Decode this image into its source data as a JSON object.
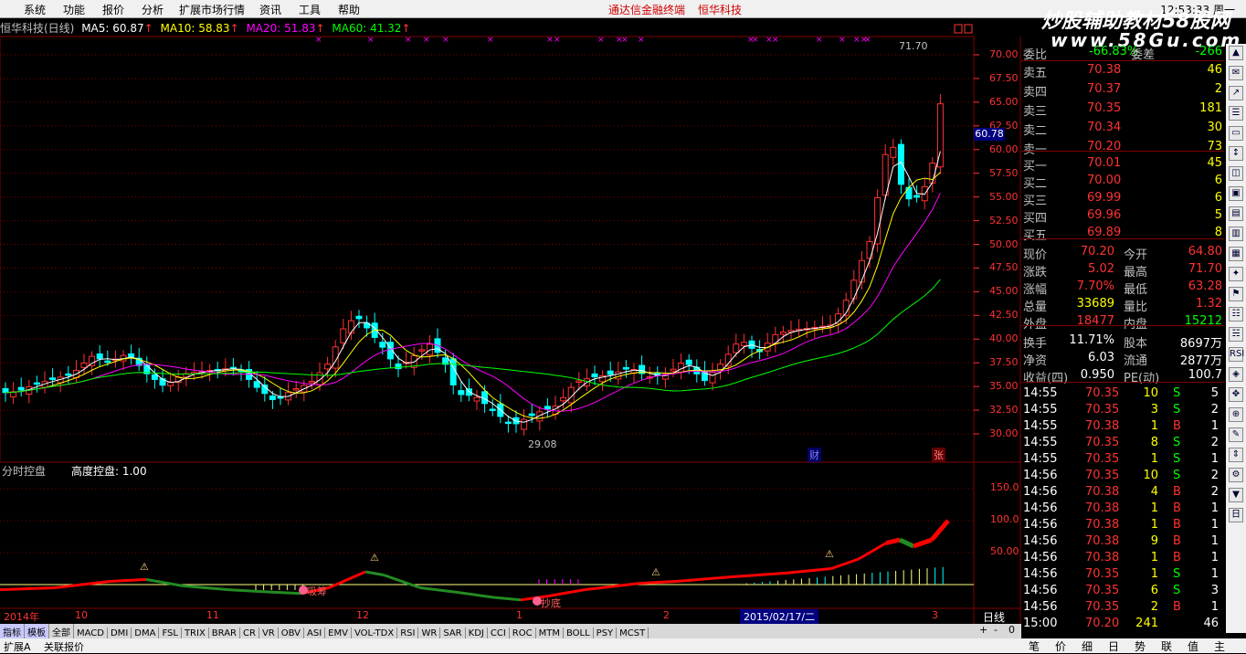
{
  "menu": {
    "items": [
      "系统",
      "功能",
      "报价",
      "分析",
      "扩展市场行情",
      "资讯",
      "工具",
      "帮助"
    ],
    "center_title": "通达信金融终端",
    "center_stock": "恒华科技",
    "clock": "12:53:33 周一"
  },
  "watermark": {
    "line1": "炒股辅助教材58股网",
    "line2": "www.58Gu.com"
  },
  "chart_title": {
    "stock": "恒华科技(日线)",
    "ma5": "MA5: 60.87",
    "ma10": "MA10: 58.83",
    "ma20": "MA20: 51.83",
    "ma60": "MA60: 41.32"
  },
  "price_axis": [
    "70.00",
    "67.50",
    "65.00",
    "62.50",
    "60.00",
    "57.50",
    "55.00",
    "52.50",
    "50.00",
    "47.50",
    "45.00",
    "42.50",
    "40.00",
    "37.50",
    "35.00",
    "32.50",
    "30.00"
  ],
  "crosshair_price": "60.78",
  "high_label": "71.70",
  "low_label": "29.08",
  "markers": {
    "cai": "财",
    "zhang": "张"
  },
  "indicator": {
    "title": "分时控盘",
    "subtitle": "高度控盘: 1.00",
    "axis": [
      "150.0",
      "100.0",
      "50.00"
    ],
    "buy_label": "吸筹",
    "bottom_label": "抄底"
  },
  "date_axis": [
    "2014年",
    "10",
    "11",
    "12",
    "1",
    "2",
    "2015/02/17/二",
    "3"
  ],
  "period": "日线",
  "tabs": [
    "指标",
    "模板",
    "全部",
    "MACD",
    "DMI",
    "DMA",
    "FSL",
    "TRIX",
    "BRAR",
    "CR",
    "VR",
    "OBV",
    "ASI",
    "EMV",
    "VOL-TDX",
    "RSI",
    "WR",
    "SAR",
    "KDJ",
    "CCI",
    "ROC",
    "MTM",
    "BOLL",
    "PSY",
    "MCST"
  ],
  "tab_controls": [
    "+",
    "-",
    "0"
  ],
  "status": {
    "left1": "扩展A",
    "left2": "关联报价"
  },
  "quote": {
    "weibi": {
      "label": "委比",
      "value": "-66.83%",
      "label2": "委差",
      "value2": "-266"
    },
    "sell": [
      {
        "label": "卖五",
        "price": "70.38",
        "vol": "46"
      },
      {
        "label": "卖四",
        "price": "70.37",
        "vol": "2"
      },
      {
        "label": "卖三",
        "price": "70.35",
        "vol": "181"
      },
      {
        "label": "卖二",
        "price": "70.34",
        "vol": "30"
      },
      {
        "label": "卖一",
        "price": "70.20",
        "vol": "73"
      }
    ],
    "buy": [
      {
        "label": "买一",
        "price": "70.01",
        "vol": "45"
      },
      {
        "label": "买二",
        "price": "70.00",
        "vol": "6"
      },
      {
        "label": "买三",
        "price": "69.99",
        "vol": "6"
      },
      {
        "label": "买四",
        "price": "69.96",
        "vol": "5"
      },
      {
        "label": "买五",
        "price": "69.89",
        "vol": "8"
      }
    ],
    "stats": [
      {
        "l1": "现价",
        "v1": "70.20",
        "l2": "今开",
        "v2": "64.80"
      },
      {
        "l1": "涨跌",
        "v1": "5.02",
        "l2": "最高",
        "v2": "71.70"
      },
      {
        "l1": "涨幅",
        "v1": "7.70%",
        "l2": "最低",
        "v2": "63.28"
      },
      {
        "l1": "总量",
        "v1": "33689",
        "l2": "量比",
        "v2": "1.32"
      },
      {
        "l1": "外盘",
        "v1": "18477",
        "l2": "内盘",
        "v2": "15212"
      }
    ],
    "stats2": [
      {
        "l1": "换手",
        "v1": "11.71%",
        "l2": "股本",
        "v2": "8697万"
      },
      {
        "l1": "净资",
        "v1": "6.03",
        "l2": "流通",
        "v2": "2877万"
      },
      {
        "l1": "收益(四)",
        "v1": "0.950",
        "l2": "PE(动)",
        "v2": "100.7"
      }
    ],
    "ticks": [
      {
        "t": "14:55",
        "p": "70.35",
        "v": "10",
        "s": "S",
        "n": "5"
      },
      {
        "t": "14:55",
        "p": "70.35",
        "v": "3",
        "s": "S",
        "n": "2"
      },
      {
        "t": "14:55",
        "p": "70.38",
        "v": "1",
        "s": "B",
        "n": "1"
      },
      {
        "t": "14:55",
        "p": "70.35",
        "v": "8",
        "s": "S",
        "n": "2"
      },
      {
        "t": "14:55",
        "p": "70.35",
        "v": "1",
        "s": "S",
        "n": "1"
      },
      {
        "t": "14:56",
        "p": "70.35",
        "v": "10",
        "s": "S",
        "n": "2"
      },
      {
        "t": "14:56",
        "p": "70.38",
        "v": "4",
        "s": "B",
        "n": "2"
      },
      {
        "t": "14:56",
        "p": "70.38",
        "v": "1",
        "s": "B",
        "n": "1"
      },
      {
        "t": "14:56",
        "p": "70.38",
        "v": "1",
        "s": "B",
        "n": "1"
      },
      {
        "t": "14:56",
        "p": "70.38",
        "v": "9",
        "s": "B",
        "n": "1"
      },
      {
        "t": "14:56",
        "p": "70.38",
        "v": "1",
        "s": "B",
        "n": "1"
      },
      {
        "t": "14:56",
        "p": "70.35",
        "v": "1",
        "s": "S",
        "n": "1"
      },
      {
        "t": "14:56",
        "p": "70.35",
        "v": "6",
        "s": "S",
        "n": "3"
      },
      {
        "t": "14:56",
        "p": "70.35",
        "v": "2",
        "s": "B",
        "n": "1"
      },
      {
        "t": "15:00",
        "p": "70.20",
        "v": "241",
        "s": "",
        "n": "46"
      }
    ]
  },
  "quote_tabs": [
    "笔",
    "价",
    "细",
    "日",
    "势",
    "联",
    "值",
    "主"
  ],
  "colors": {
    "up": "#ff3232",
    "down": "#00ffff",
    "ma5": "#ffffff",
    "ma10": "#ffff00",
    "ma20": "#ff00ff",
    "ma60": "#00ff00",
    "grid": "#800000"
  }
}
